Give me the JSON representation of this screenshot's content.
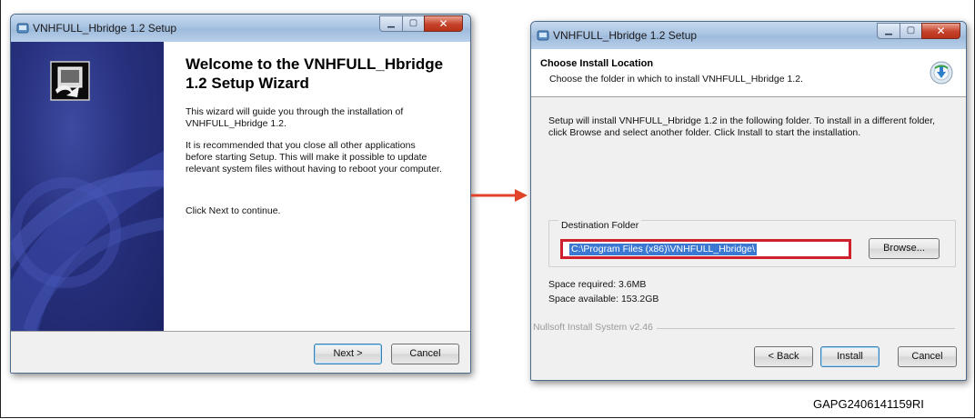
{
  "figure_title": "",
  "colors": {
    "highlight_box": "#d0202e",
    "arrow": "#e0432a",
    "selection": "#3b78d2",
    "side_panel": "#27307d"
  },
  "welcome_window": {
    "title": "VNHFULL_Hbridge 1.2 Setup",
    "icon": "installer-app-icon",
    "heading": "Welcome to the VNHFULL_Hbridge 1.2 Setup Wizard",
    "para1": "This wizard will guide you through the installation of VNHFULL_Hbridge 1.2.",
    "para2": "It is recommended that you close all other applications before starting Setup. This will make it possible to update relevant system files without having to reboot your computer.",
    "para3": "Click Next to continue.",
    "next_label": "Next >",
    "cancel_label": "Cancel"
  },
  "location_window": {
    "title": "VNHFULL_Hbridge 1.2 Setup",
    "header_title": "Choose Install Location",
    "header_subtitle": "Choose the folder in which to install VNHFULL_Hbridge 1.2.",
    "body_text": "Setup will install VNHFULL_Hbridge 1.2 in the following folder. To install in a different folder, click Browse and select another folder. Click Install to start the installation.",
    "destination_label": "Destination Folder",
    "destination_path": "C:\\Program Files (x86)\\VNHFULL_Hbridge\\",
    "browse_label": "Browse...",
    "space_required": "Space required: 3.6MB",
    "space_available": "Space available: 153.2GB",
    "nsis_label": "Nullsoft Install System v2.46",
    "back_label": "< Back",
    "install_label": "Install",
    "cancel_label": "Cancel"
  },
  "figure_code": "GAPG2406141159RI"
}
